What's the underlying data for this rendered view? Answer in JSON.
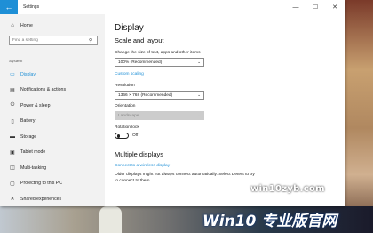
{
  "window": {
    "title": "Settings",
    "back_glyph": "←",
    "controls": [
      "—",
      "☐",
      "✕"
    ]
  },
  "sidebar": {
    "home": {
      "label": "Home",
      "icon": "home-icon",
      "glyph": "⌂"
    },
    "search": {
      "placeholder": "Find a setting",
      "icon": "search-icon",
      "glyph": "⚲"
    },
    "section": "System",
    "items": [
      {
        "label": "Display",
        "icon": "display-icon",
        "glyph": "▭",
        "active": true
      },
      {
        "label": "Notifications & actions",
        "icon": "notifications-icon",
        "glyph": "▤"
      },
      {
        "label": "Power & sleep",
        "icon": "power-icon",
        "glyph": "⏻"
      },
      {
        "label": "Battery",
        "icon": "battery-icon",
        "glyph": "▯"
      },
      {
        "label": "Storage",
        "icon": "storage-icon",
        "glyph": "▬"
      },
      {
        "label": "Tablet mode",
        "icon": "tablet-icon",
        "glyph": "▣"
      },
      {
        "label": "Multi-tasking",
        "icon": "multitasking-icon",
        "glyph": "◫"
      },
      {
        "label": "Projecting to this PC",
        "icon": "projecting-icon",
        "glyph": "▢"
      },
      {
        "label": "Shared experiences",
        "icon": "shared-icon",
        "glyph": "✕"
      }
    ]
  },
  "main": {
    "title": "Display",
    "scale_heading": "Scale and layout",
    "scale_label": "Change the size of text, apps and other items",
    "scale_value": "100% (Recommended)",
    "custom_scaling": "Custom scaling",
    "resolution_label": "Resolution",
    "resolution_value": "1366 × 768 (Recommended)",
    "orientation_label": "Orientation",
    "orientation_value": "Landscape",
    "rotation_label": "Rotation lock",
    "rotation_state": "Off",
    "multi_heading": "Multiple displays",
    "connect_link": "Connect to a wireless display",
    "multi_text": "Older displays might not always connect automatically. Select Detect to try to connect to them."
  },
  "watermark": {
    "small": "win10zyb.com",
    "large": "Win10 专业版官网"
  },
  "colors": {
    "accent": "#1e8fd6",
    "sidebar_bg": "#f2f2f2"
  }
}
